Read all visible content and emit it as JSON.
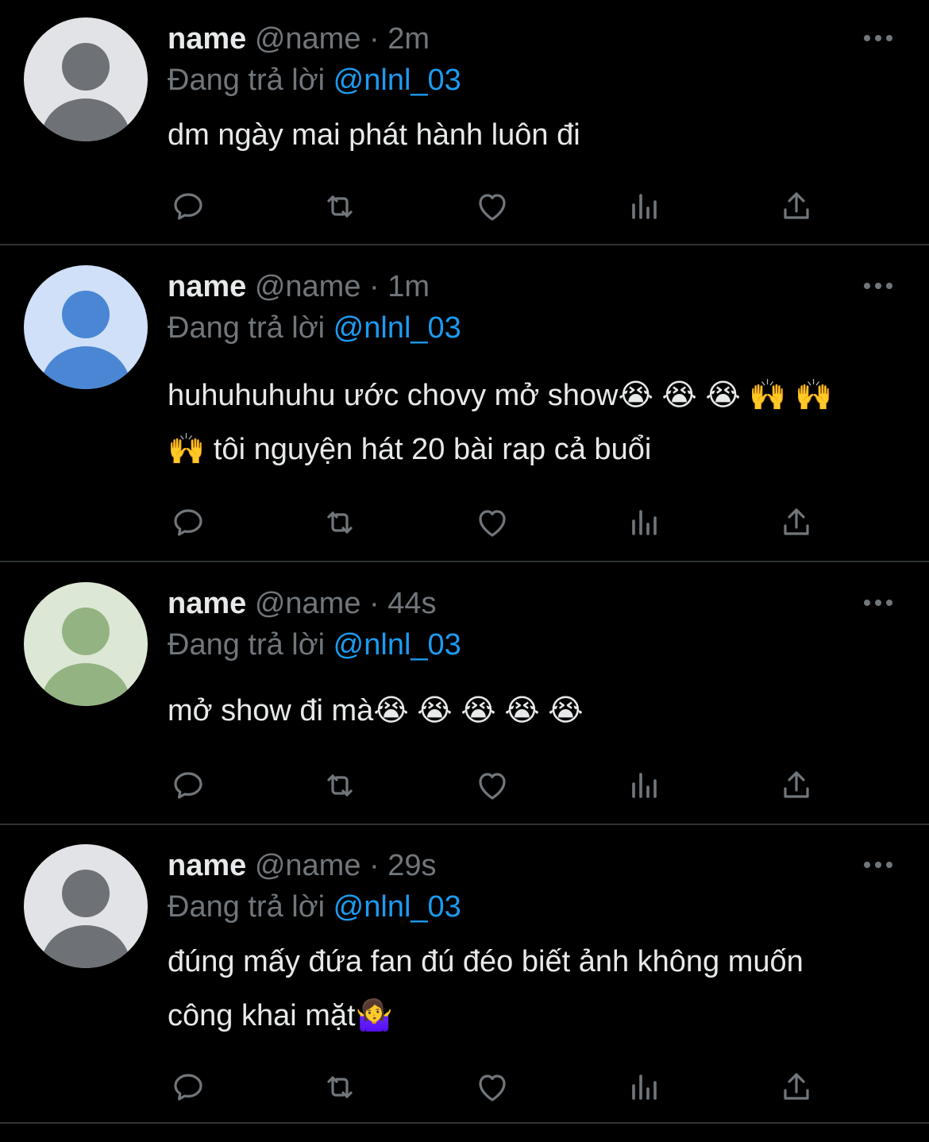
{
  "theme": {
    "background": "#000000",
    "text": "#e7e9ea",
    "muted": "#71767b",
    "accent": "#1d9bf0",
    "divider": "#2f3336"
  },
  "actions_icons": [
    "reply-icon",
    "retweet-icon",
    "like-icon",
    "views-icon",
    "share-icon"
  ],
  "tweets": [
    {
      "display_name": "name",
      "handle": "@name",
      "separator": "·",
      "time": "2m",
      "reply_prefix": "Đang trả lời",
      "reply_to": "@nlnl_03",
      "text": "dm ngày mai phát hành luôn đi",
      "avatar": {
        "bg": "#e1e3e6",
        "fg": "#6e7176"
      }
    },
    {
      "display_name": "name",
      "handle": "@name",
      "separator": "·",
      "time": "1m",
      "reply_prefix": "Đang trả lời",
      "reply_to": "@nlnl_03",
      "text": "huhuhuhuhu ước chovy mở show😭 😭 😭 🙌 🙌 🙌 tôi nguyện hát 20 bài rap cả buổi",
      "avatar": {
        "bg": "#cfe0f8",
        "fg": "#4a86d4"
      }
    },
    {
      "display_name": "name",
      "handle": "@name",
      "separator": "·",
      "time": "44s",
      "reply_prefix": "Đang trả lời",
      "reply_to": "@nlnl_03",
      "text": "mở show đi mà😭 😭 😭 😭 😭",
      "avatar": {
        "bg": "#dde7d5",
        "fg": "#93b482"
      }
    },
    {
      "display_name": "name",
      "handle": "@name",
      "separator": "·",
      "time": "29s",
      "reply_prefix": "Đang trả lời",
      "reply_to": "@nlnl_03",
      "text": "đúng mấy đứa fan đú đéo biết  ảnh không muốn công khai mặt🤷‍♀️",
      "avatar": {
        "bg": "#e1e3e6",
        "fg": "#6e7176"
      }
    }
  ]
}
